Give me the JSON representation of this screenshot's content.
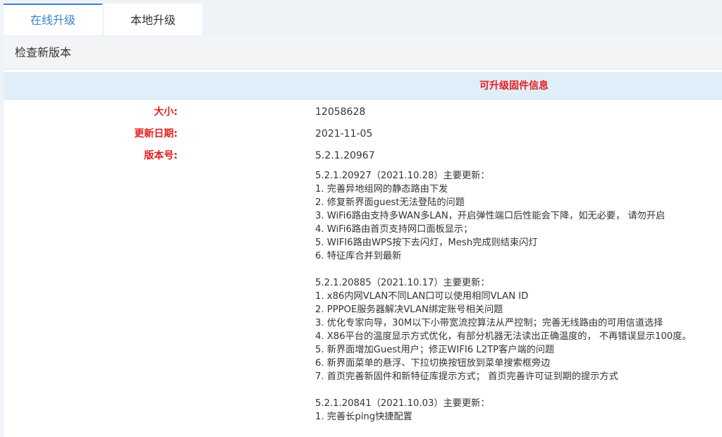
{
  "tabs": [
    {
      "label": "在线升级"
    },
    {
      "label": "本地升级"
    }
  ],
  "section": {
    "title": "检查新版本",
    "info_bar": "可升级固件信息"
  },
  "info": {
    "size_label": "大小:",
    "size_value": "12058628",
    "date_label": "更新日期:",
    "date_value": "2021-11-05",
    "version_label": "版本号:",
    "version_value": "5.2.1.20967"
  },
  "release_notes": [
    {
      "title": "5.2.1.20927（2021.10.28）主要更新：",
      "items": [
        "1. 完善异地组网的静态路由下发",
        "2. 修复新界面guest无法登陆的问题",
        "3. WiFi6路由支持多WAN多LAN，开启弹性端口后性能会下降，如无必要， 请勿开启",
        "4. WiFi6路由首页支持网口面板显示；",
        "5. WIFI6路由WPS按下去闪灯，Mesh完成则结束闪灯",
        "6. 特征库合并到最新"
      ]
    },
    {
      "title": "5.2.1.20885（2021.10.17）主要更新：",
      "items": [
        "1. x86内网VLAN不同LAN口可以使用相同VLAN ID",
        "2. PPPOE服务器解决VLAN绑定账号相关问题",
        "3. 优化专家向导，30M以下小带宽流控算法从严控制；完善无线路由的可用信道选择",
        "4. X86平台的温度显示方式优化，有部分机器无法读出正确温度的， 不再错误显示100度。",
        "5. 新界面增加Guest用户；修正WIFI6 L2TP客户端的问题",
        "6. 新界面菜单的悬浮、下拉切换按钮放到菜单搜索框旁边",
        "7. 首页完善新固件和新特征库提示方式； 首页完善许可证到期的提示方式"
      ]
    },
    {
      "title": "5.2.1.20841（2021.10.03）主要更新：",
      "items": [
        "1. 完善长ping快捷配置"
      ]
    }
  ]
}
